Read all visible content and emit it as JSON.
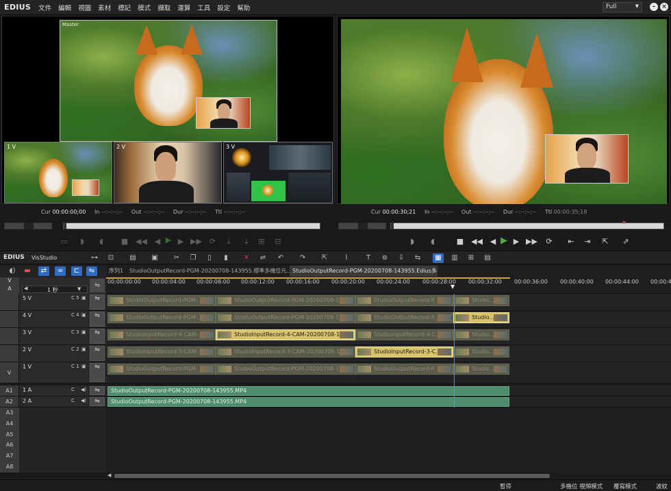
{
  "app": {
    "logo": "EDIUS"
  },
  "menu": [
    "文件",
    "編輯",
    "視圖",
    "素材",
    "標記",
    "模式",
    "擷取",
    "運算",
    "工具",
    "設定",
    "幫助"
  ],
  "view_mode": "Full",
  "source_player": {
    "label": "Master",
    "cams": [
      "1 V",
      "2 V",
      "3 V"
    ],
    "cur": "00:00:00;00",
    "in": "--:--:--;--",
    "out": "--:--:--;--",
    "dur": "--:--:--;--",
    "ttl": "--:--:--;--"
  },
  "record_player": {
    "cur": "00:00:30;21",
    "in": "--:--:--;--",
    "out": "--:--:--;--",
    "dur": "--:--:--;--",
    "ttl": "00:00:35;18"
  },
  "tc_labels": {
    "cur": "Cur",
    "in": "In",
    "out": "Out",
    "dur": "Dur",
    "ttl": "Ttl"
  },
  "timeline": {
    "project": "VisStudio",
    "logo": "EDIUS",
    "zoom": "1 秒",
    "tabs": [
      "序列1",
      "StudioOutputRecord-PGM-20200708-143955.標準多機位元...",
      "StudioOutputRecord-PGM-20200708-143955.Edius多..."
    ],
    "ruler": [
      "00:00:00:00",
      "00:00:04:00",
      "00:00:08:00",
      "00:00:12:00",
      "00:00:16:00",
      "00:00:20:00",
      "00:00:24:00",
      "00:00:28:00",
      "00:00:32:00",
      "00:00:36:00",
      "00:00:40:00",
      "00:00:44:00",
      "00:00:4"
    ],
    "tracks": [
      {
        "name": "5 V",
        "ch": "C 5",
        "clips": [
          "StudioOutputRecord-PGM-...",
          "StudioOutputRecord-PGM-20200708-1...",
          "StudioOutputRecord-P...",
          "Studio..."
        ]
      },
      {
        "name": "4 V",
        "ch": "C 4",
        "clips": [
          "StudioOutputRecord-PGM-...",
          "StudioOutputRecord-PGM-20200708-1...",
          "StudioOutputRecord-P...",
          "Studio..."
        ]
      },
      {
        "name": "3 V",
        "ch": "C 3",
        "clips": [
          "StudioInputRecord-4-CAM-...",
          "StudioInputRecord-4-CAM-20200708-1...",
          "StudioInputRecord-4-C...",
          "Studio..."
        ]
      },
      {
        "name": "2 V",
        "ch": "C 2",
        "clips": [
          "StudioInputRecord-3-CAM-...",
          "StudioInputRecord-3-CAM-20200708-1...",
          "StudioInputRecord-3-C...",
          "Studio..."
        ]
      },
      {
        "name": "1 V",
        "ch": "C 1",
        "clips": [
          "StudioOutputRecord-PGM-...",
          "StudioOutputRecord-PGM-20200708-1...",
          "StudioOutputRecord-P...",
          "Studio..."
        ]
      }
    ],
    "audio_tracks": [
      {
        "id": "A1",
        "name": "1 A",
        "ch": "C",
        "clip": "StudioOutputRecord-PGM-20200708-143955.MP4"
      },
      {
        "id": "A2",
        "name": "2 A",
        "ch": "C",
        "clip": "StudioOutputRecord-PGM-20200708-143955.MP4"
      }
    ],
    "empty_audio": [
      "A3",
      "A4",
      "A5",
      "A6",
      "A7",
      "A8"
    ],
    "v_labels": [
      "V",
      "A"
    ],
    "side_v": "V"
  },
  "status": {
    "pause": "暫停",
    "multicam": "多機位 視頻模式",
    "overwrite": "覆寫模式",
    "ripple": "波紋"
  }
}
